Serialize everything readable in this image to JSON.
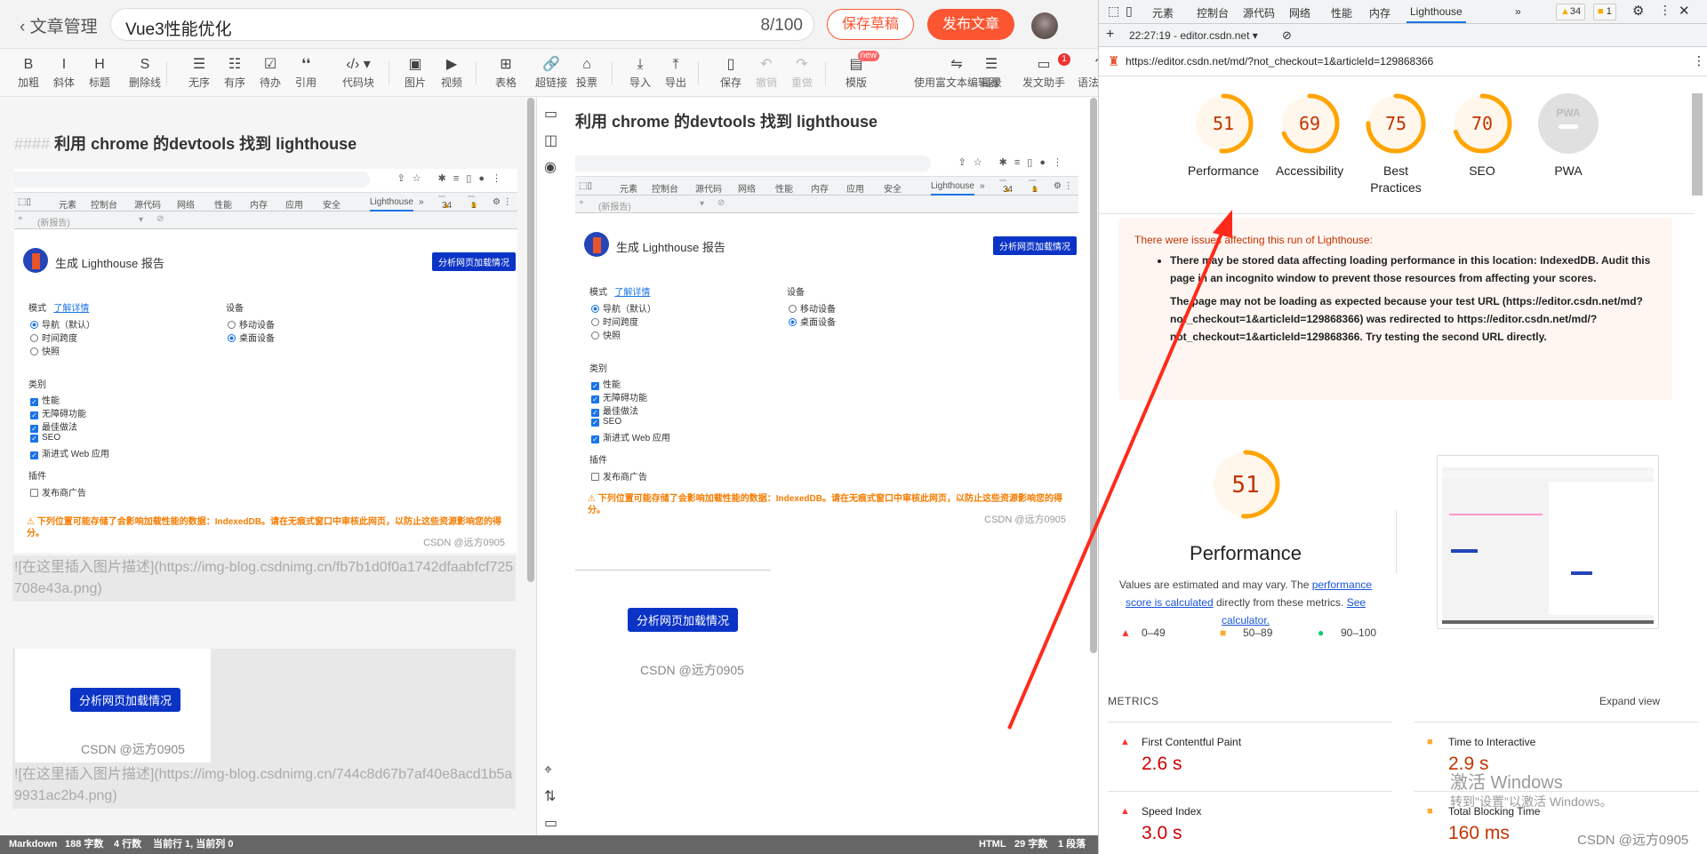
{
  "header": {
    "back_label": "文章管理",
    "title_value": "Vue3性能优化",
    "title_count": "8/100",
    "save_draft": "保存草稿",
    "publish": "发布文章"
  },
  "toolbar": [
    {
      "icon": "B",
      "label": "加粗",
      "name": "bold"
    },
    {
      "icon": "I",
      "label": "斜体",
      "name": "italic"
    },
    {
      "icon": "H",
      "label": "标题",
      "name": "heading"
    },
    {
      "icon": "S",
      "label": "删除线",
      "name": "strikethrough"
    },
    {
      "icon": "☰",
      "label": "无序",
      "name": "unordered-list"
    },
    {
      "icon": "☷",
      "label": "有序",
      "name": "ordered-list"
    },
    {
      "icon": "☑",
      "label": "待办",
      "name": "todo"
    },
    {
      "icon": "❛❛",
      "label": "引用",
      "name": "quote"
    },
    {
      "icon": "‹/› ▾",
      "label": "代码块",
      "name": "code-block"
    },
    {
      "icon": "▣",
      "label": "图片",
      "name": "image"
    },
    {
      "icon": "▶",
      "label": "视频",
      "name": "video"
    },
    {
      "icon": "⊞",
      "label": "表格",
      "name": "table"
    },
    {
      "icon": "🔗",
      "label": "超链接",
      "name": "link"
    },
    {
      "icon": "⌂",
      "label": "投票",
      "name": "vote"
    },
    {
      "icon": "⤓",
      "label": "导入",
      "name": "import"
    },
    {
      "icon": "⤒",
      "label": "导出",
      "name": "export"
    },
    {
      "icon": "▯",
      "label": "保存",
      "name": "save"
    },
    {
      "icon": "↶",
      "label": "撤销",
      "name": "undo",
      "disabled": true
    },
    {
      "icon": "↷",
      "label": "重做",
      "name": "redo",
      "disabled": true
    },
    {
      "icon": "▤",
      "label": "模版",
      "name": "template",
      "badge": "new"
    },
    {
      "icon": "⇋",
      "label": "使用富文本编辑器",
      "name": "rich-text"
    },
    {
      "icon": "☰",
      "label": "目录",
      "name": "toc"
    },
    {
      "icon": "▭",
      "label": "发文助手",
      "name": "assistant",
      "count": "1"
    },
    {
      "icon": "?",
      "label": "语法说明",
      "name": "syntax-help"
    }
  ],
  "editor": {
    "heading_marker": "####",
    "heading_text": "利用 chrome 的devtools 找到 lighthouse",
    "md_image_1": "![在这里插入图片描述](https://img-blog.csdnimg.cn/fb7b1d0f0a1742dfaabfcf725708e43a.png)",
    "md_image_2": "![在这里插入图片描述](https://img-blog.csdnimg.cn/744c8d67b7af40e8acd1b5a9931ac2b4.png)"
  },
  "preview": {
    "heading": "利用 chrome 的devtools 找到 lighthouse"
  },
  "embedded_panel": {
    "tabs": [
      "元素",
      "控制台",
      "源代码",
      "网络",
      "性能",
      "内存",
      "应用",
      "安全",
      "Lighthouse"
    ],
    "more": "»",
    "warnings": "34",
    "issues": "1",
    "new_report": "(新报告)",
    "title": "生成 Lighthouse 报告",
    "analyze_button": "分析网页加载情况",
    "mode_label": "模式",
    "learn_more": "了解详情",
    "modes": [
      "导航（默认）",
      "时间跨度",
      "快照"
    ],
    "device_label": "设备",
    "devices": [
      "移动设备",
      "桌面设备"
    ],
    "category_label": "类别",
    "categories": [
      "性能",
      "无障碍功能",
      "最佳做法",
      "SEO",
      "渐进式 Web 应用"
    ],
    "plugin_label": "插件",
    "plugins": [
      "发布商广告"
    ],
    "warning": "⚠  下列位置可能存储了会影响加载性能的数据：IndexedDB。请在无痕式窗口中审核此网页，以防止这些资源影响您的得分。",
    "watermark": "CSDN @远方0905"
  },
  "status_left": {
    "mode": "Markdown",
    "chars": "188 字数",
    "lines": "4 行数",
    "cursor": "当前行 1, 当前列 0"
  },
  "status_right": {
    "mode": "HTML",
    "chars": "29 字数",
    "paras": "1 段落"
  },
  "devtools": {
    "tabs": [
      "元素",
      "控制台",
      "源代码",
      "网络",
      "性能",
      "内存",
      "Lighthouse"
    ],
    "active_tab": "Lighthouse",
    "more": "»",
    "warnings": "34",
    "issues": "1",
    "report_select": "22:27:19 - editor.csdn.net",
    "url": "https://editor.csdn.net/md/?not_checkout=1&articleId=129868366",
    "scores": [
      {
        "label": "Performance",
        "value": 51
      },
      {
        "label": "Accessibility",
        "value": 69
      },
      {
        "label": "Best Practices",
        "value": 75
      },
      {
        "label": "SEO",
        "value": 70
      },
      {
        "label": "PWA",
        "value": null,
        "badge": "PWA"
      }
    ],
    "colors": {
      "average": "#ffa400",
      "average_bg": "#fff7ec",
      "average_text": "#c33300",
      "fail": "#ff3333",
      "pass": "#0cce6b",
      "link": "#1a55d6"
    },
    "warning_heading": "There were issues affecting this run of Lighthouse:",
    "warning_items": [
      "There may be stored data affecting loading performance in this location: IndexedDB. Audit this page in an incognito window to prevent those resources from affecting your scores.",
      "The page may not be loading as expected because your test URL (https://editor.csdn.net/md?not_checkout=1&articleId=129868366) was redirected to https://editor.csdn.net/md/?not_checkout=1&articleId=129868366. Try testing the second URL directly."
    ],
    "perf_score": 51,
    "perf_title": "Performance",
    "perf_desc_1": "Values are estimated and may vary. The ",
    "perf_link_1": "performance score is calculated",
    "perf_desc_2": " directly from these metrics. ",
    "perf_link_2": "See calculator.",
    "legend": [
      "0–49",
      "50–89",
      "90–100"
    ],
    "metrics_heading": "METRICS",
    "expand_view": "Expand view",
    "metrics": [
      {
        "name": "First Contentful Paint",
        "value": "2.6 s",
        "rating": "fail"
      },
      {
        "name": "Time to Interactive",
        "value": "2.9 s",
        "rating": "average"
      },
      {
        "name": "Speed Index",
        "value": "3.0 s",
        "rating": "fail"
      },
      {
        "name": "Total Blocking Time",
        "value": "160 ms",
        "rating": "average"
      }
    ]
  },
  "overlay": {
    "activate_title": "激活 Windows",
    "activate_sub": "转到\"设置\"以激活 Windows。",
    "watermark": "CSDN @远方0905",
    "arrow_color": "#ff2a1a"
  }
}
